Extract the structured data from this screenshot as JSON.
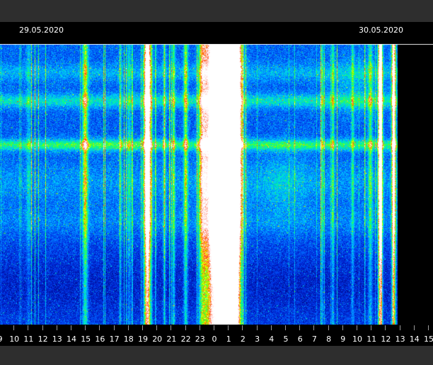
{
  "chart_data": {
    "type": "heatmap",
    "dates": [
      "29.05.2020",
      "30.05.2020"
    ],
    "x_ticks": [
      "9",
      "10",
      "11",
      "12",
      "13",
      "14",
      "15",
      "16",
      "17",
      "18",
      "19",
      "20",
      "21",
      "22",
      "23",
      "0",
      "1",
      "2",
      "3",
      "4",
      "5",
      "6",
      "7",
      "8",
      "9",
      "10",
      "11",
      "12",
      "13",
      "14",
      "15"
    ],
    "colormap": [
      "#00006e",
      "#0040ff",
      "#00c8ff",
      "#00ff60",
      "#ffff00",
      "#ff3000",
      "#ffffff"
    ],
    "data_ends_at_hour": "13",
    "bright_bursts_hours": [
      "19.5",
      "23.5-1.5",
      "12"
    ]
  }
}
